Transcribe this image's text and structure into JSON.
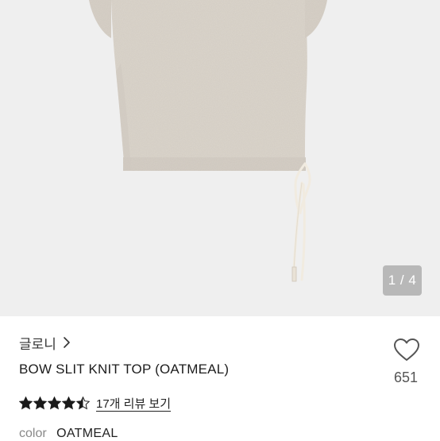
{
  "gallery": {
    "image_subject": "oatmeal knit top with bow tie slit",
    "counter_text": "1 / 4",
    "background": "#efefef",
    "garment_color": "#dcd5cc",
    "tie_color": "#f1ebe0"
  },
  "product": {
    "brand": "글로니",
    "title": "BOW SLIT KNIT TOP (OATMEAL)",
    "like_count": "651",
    "rating": 4.5,
    "rating_max": 5,
    "review_link": "17개 리뷰 보기",
    "option_label": "color",
    "option_value": "OATMEAL"
  },
  "colors": {
    "star": "#1a1a1a",
    "heart_outline": "#555555"
  }
}
